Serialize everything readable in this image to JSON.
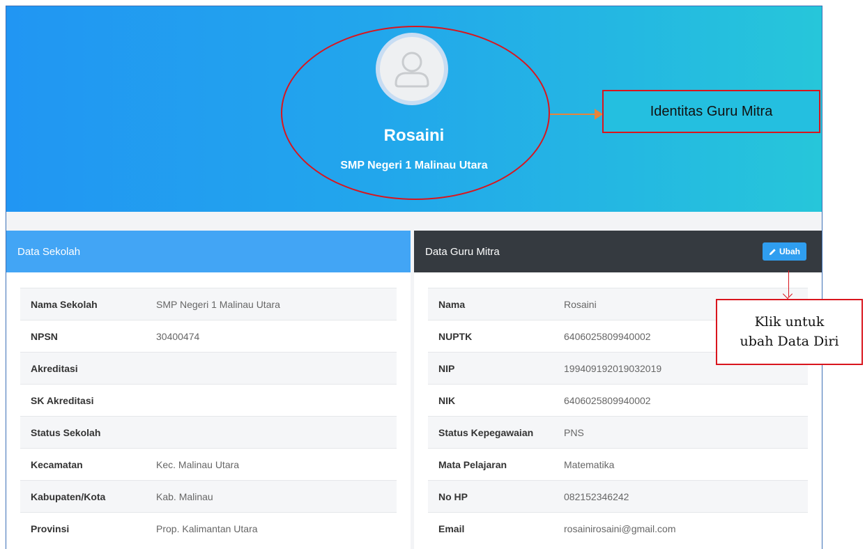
{
  "profile": {
    "name": "Rosaini",
    "school": "SMP Negeri 1 Malinau Utara"
  },
  "annotations": {
    "identity_callout": "Identitas Guru Mitra",
    "edit_callout_line1": "Klik untuk",
    "edit_callout_line2": "ubah Data Diri"
  },
  "school_panel": {
    "title": "Data Sekolah",
    "rows": [
      {
        "label": "Nama Sekolah",
        "value": "SMP Negeri 1 Malinau Utara"
      },
      {
        "label": "NPSN",
        "value": "30400474"
      },
      {
        "label": "Akreditasi",
        "value": ""
      },
      {
        "label": "SK Akreditasi",
        "value": ""
      },
      {
        "label": "Status Sekolah",
        "value": ""
      },
      {
        "label": "Kecamatan",
        "value": "Kec. Malinau Utara"
      },
      {
        "label": "Kabupaten/Kota",
        "value": "Kab. Malinau"
      },
      {
        "label": "Provinsi",
        "value": "Prop. Kalimantan Utara"
      }
    ]
  },
  "teacher_panel": {
    "title": "Data Guru Mitra",
    "edit_label": "Ubah",
    "edit_icon": "pencil-icon",
    "rows": [
      {
        "label": "Nama",
        "value": "Rosaini"
      },
      {
        "label": "NUPTK",
        "value": "6406025809940002"
      },
      {
        "label": "NIP",
        "value": "199409192019032019"
      },
      {
        "label": "NIK",
        "value": "6406025809940002"
      },
      {
        "label": "Status Kepegawaian",
        "value": "PNS"
      },
      {
        "label": "Mata Pelajaran",
        "value": "Matematika"
      },
      {
        "label": "No HP",
        "value": "082152346242"
      },
      {
        "label": "Email",
        "value": "rosainirosaini@gmail.com"
      }
    ]
  },
  "colors": {
    "hero_start": "#2196f3",
    "hero_end": "#26c6da",
    "annotation_red": "#d9151d",
    "arrow_orange": "#e8843a"
  }
}
